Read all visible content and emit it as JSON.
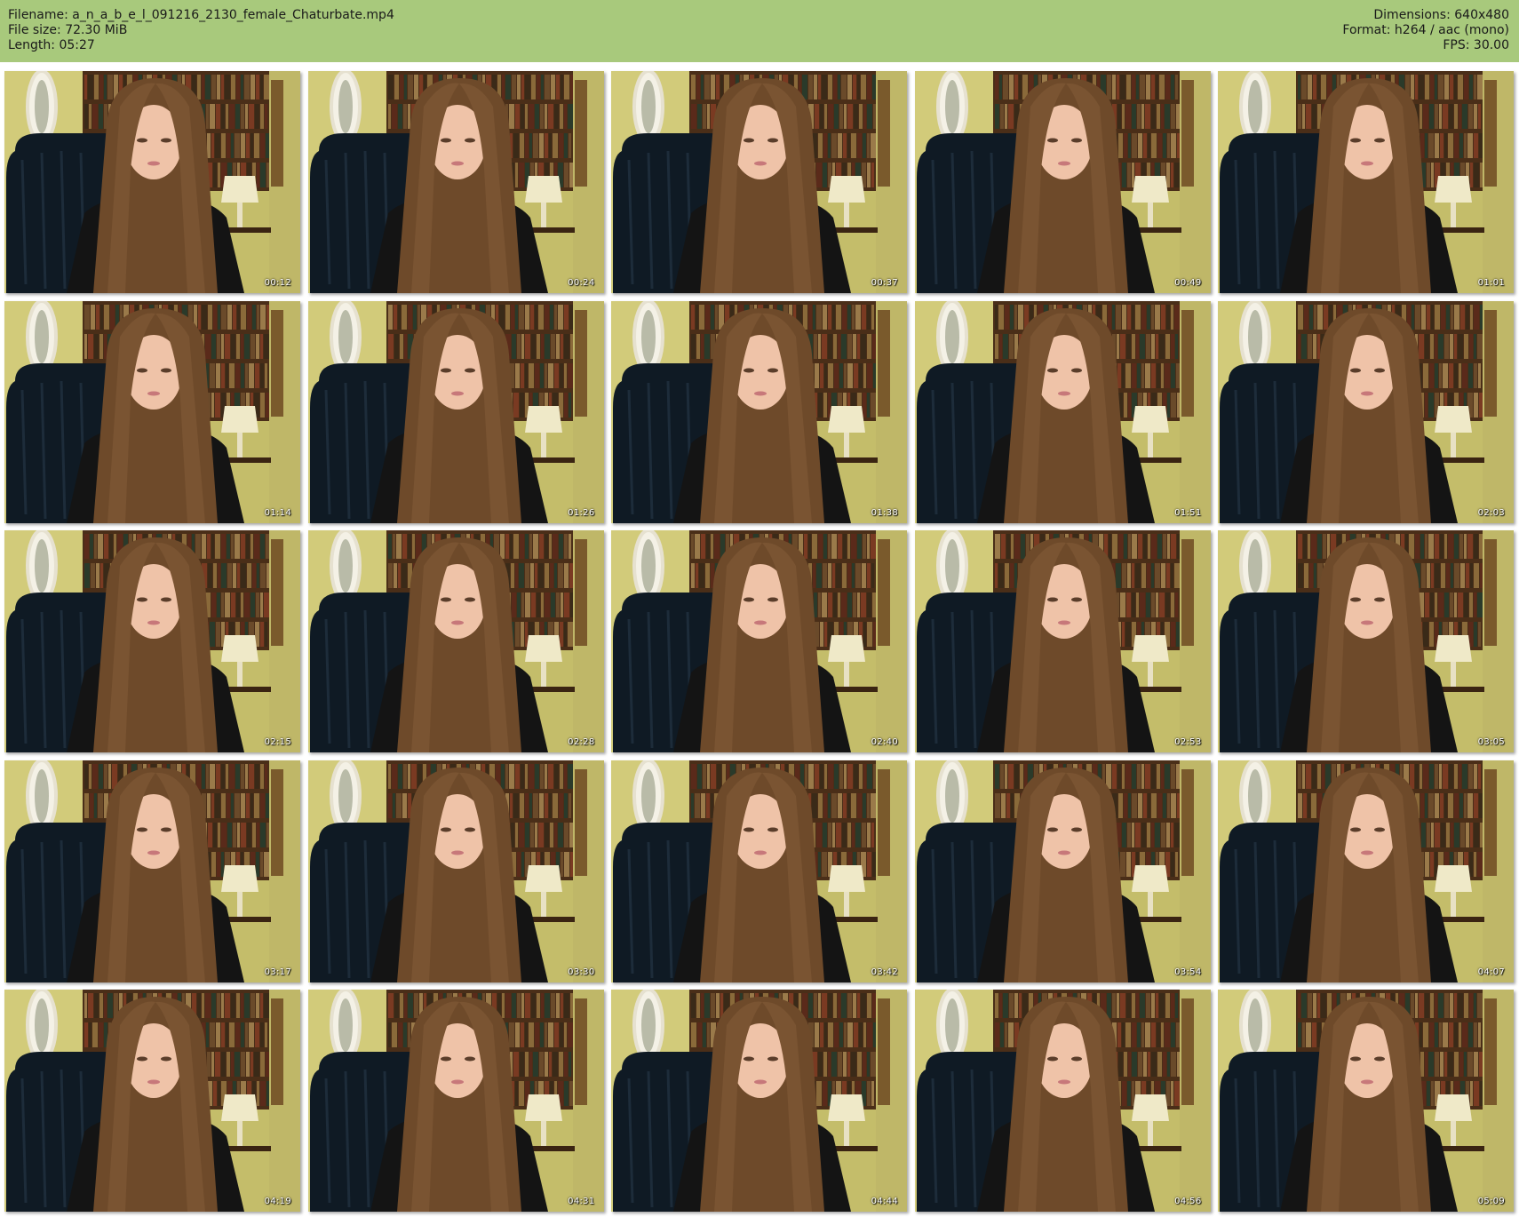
{
  "header": {
    "filename_label": "Filename: a_n_a_b_e_l_091216_2130_female_Chaturbate.mp4",
    "filesize_label": "File size: 72.30 MiB",
    "length_label": "Length: 05:27",
    "dimensions_label": "Dimensions: 640x480",
    "format_label": "Format: h264 / aac (mono)",
    "fps_label": "FPS: 30.00"
  },
  "colors": {
    "header_bg": "#a8c97c",
    "wall": "#c4bd6a",
    "shelf": "#4a2e18",
    "chair": "#0f1a24",
    "hair": "#6e4a2a"
  },
  "thumbnails": [
    {
      "timestamp": "00:12"
    },
    {
      "timestamp": "00:24"
    },
    {
      "timestamp": "00:37"
    },
    {
      "timestamp": "00:49"
    },
    {
      "timestamp": "01:01"
    },
    {
      "timestamp": "01:14"
    },
    {
      "timestamp": "01:26"
    },
    {
      "timestamp": "01:38"
    },
    {
      "timestamp": "01:51"
    },
    {
      "timestamp": "02:03"
    },
    {
      "timestamp": "02:15"
    },
    {
      "timestamp": "02:28"
    },
    {
      "timestamp": "02:40"
    },
    {
      "timestamp": "02:53"
    },
    {
      "timestamp": "03:05"
    },
    {
      "timestamp": "03:17"
    },
    {
      "timestamp": "03:30"
    },
    {
      "timestamp": "03:42"
    },
    {
      "timestamp": "03:54"
    },
    {
      "timestamp": "04:07"
    },
    {
      "timestamp": "04:19"
    },
    {
      "timestamp": "04:31"
    },
    {
      "timestamp": "04:44"
    },
    {
      "timestamp": "04:56"
    },
    {
      "timestamp": "05:09"
    }
  ]
}
